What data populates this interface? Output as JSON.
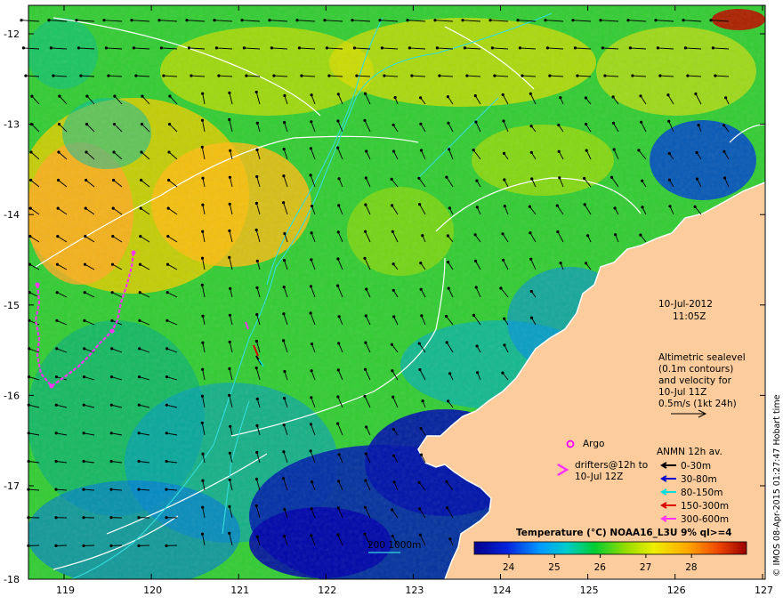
{
  "map": {
    "date": "10-Jul-2012",
    "time": "11:05Z",
    "lat_ticks": [
      "-12",
      "-13",
      "-14",
      "-15",
      "-16",
      "-17",
      "-18"
    ],
    "lon_ticks": [
      "119",
      "120",
      "121",
      "122",
      "123",
      "124",
      "125",
      "126",
      "127"
    ],
    "altimetry_note": {
      "line1": "Altimetric sealevel",
      "line2": "(0.1m contours)",
      "line3": "and velocity for",
      "line4": "10-Jul 11Z",
      "line5": "0.5m/s (1kt 24h)"
    },
    "argo_label": "Argo",
    "drifters_label_1": "drifters@12h to",
    "drifters_label_2": "10-Jul 12Z",
    "anmn_title": "ANMN 12h av.",
    "anmn_legend": [
      {
        "label": "0-30m",
        "color": "#000000"
      },
      {
        "label": "30-80m",
        "color": "#0000cc"
      },
      {
        "label": "80-150m",
        "color": "#00dddd"
      },
      {
        "label": "150-300m",
        "color": "#dd0000"
      },
      {
        "label": "300-600m",
        "color": "#ff33ff"
      }
    ],
    "depth_contours_label": "200  1000m",
    "colorbar_title": "Temperature (°C) NOAA16_L3U 9% ql>=4",
    "colorbar_ticks": [
      "24",
      "25",
      "26",
      "27",
      "28"
    ],
    "credit": "© IMOS 08-Apr-2015 01:27:47 Hobart time",
    "colors": {
      "land": "#fccc9c",
      "cold": "#00008b",
      "warm": "#a52a00",
      "argo": "#ff00ff",
      "drifter": "#ff33ff"
    }
  }
}
